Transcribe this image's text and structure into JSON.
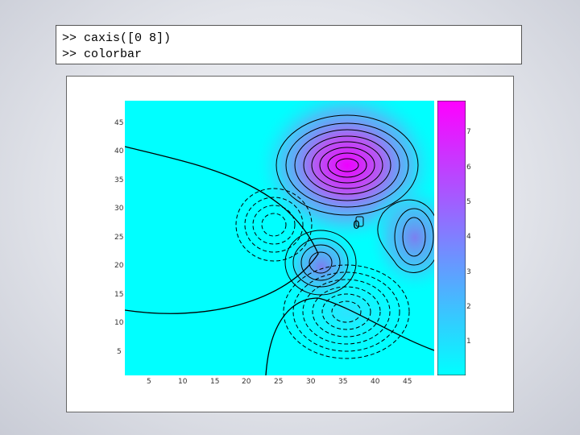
{
  "console": {
    "lines": [
      ">> caxis([0 8])",
      ">> colorbar"
    ]
  },
  "colors": {
    "low": "#00ffff",
    "high": "#ff00ff",
    "contour": "#000000"
  },
  "plot": {
    "xticks": [
      "5",
      "10",
      "15",
      "20",
      "25",
      "30",
      "35",
      "40",
      "45"
    ],
    "yticks": [
      "45",
      "40",
      "35",
      "30",
      "25",
      "20",
      "15",
      "10",
      "5"
    ],
    "inline_label": "0",
    "colorbar_ticks": [
      "7",
      "6",
      "5",
      "4",
      "3",
      "2",
      "1"
    ],
    "caxis": [
      0,
      8
    ]
  }
}
